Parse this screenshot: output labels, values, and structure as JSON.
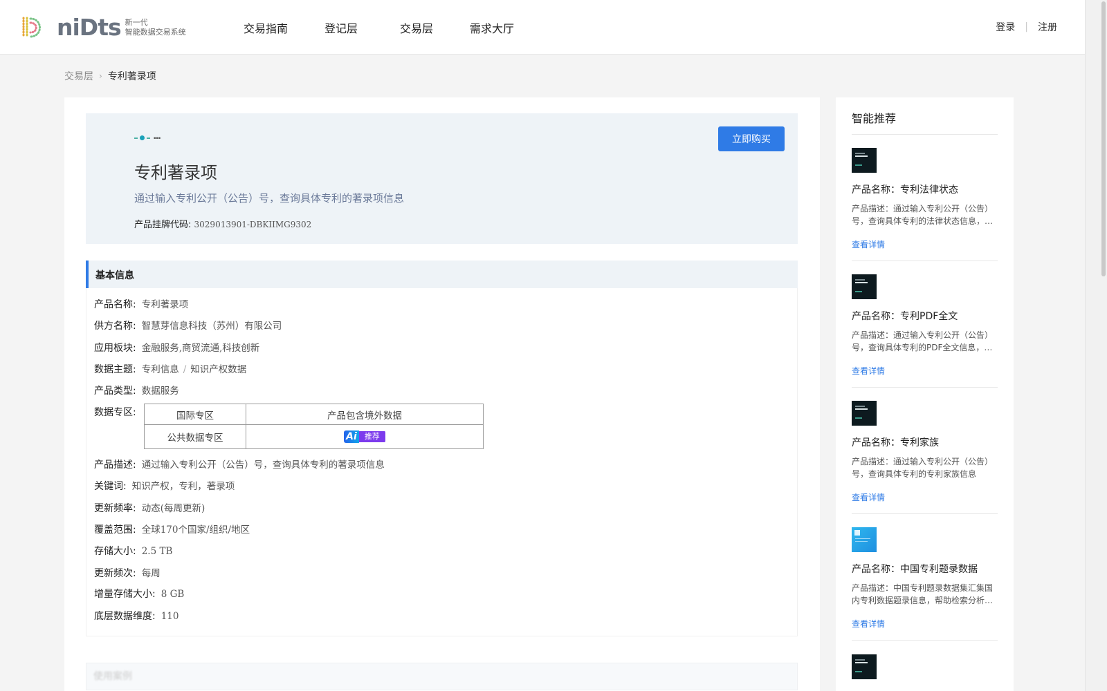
{
  "header": {
    "logo_word": "niDts",
    "logo_sub_line1": "新一代",
    "logo_sub_line2": "智能数据交易系统",
    "nav": [
      {
        "label": "交易指南"
      },
      {
        "label": "登记层"
      },
      {
        "label": "交易层"
      },
      {
        "label": "需求大厅"
      }
    ],
    "login": "登录",
    "register": "注册"
  },
  "breadcrumb": {
    "parent": "交易层",
    "current": "专利著录项"
  },
  "hero": {
    "title": "专利著录项",
    "description": "通过输入专利公开（公告）号，查询具体专利的著录项信息",
    "code_label": "产品挂牌代码:",
    "code_value": "3029013901-DBKIIMG9302",
    "buy_button": "立即购买"
  },
  "basic_info": {
    "section_title": "基本信息",
    "fields": {
      "name": {
        "label": "产品名称:",
        "value": "专利著录项"
      },
      "supplier": {
        "label": "供方名称:",
        "value": "智慧芽信息科技（苏州）有限公司"
      },
      "sector": {
        "label": "应用板块:",
        "value": "金融服务,商贸流通,科技创新"
      },
      "topic": {
        "label": "数据主题:",
        "value_a": "专利信息",
        "value_sep": "/",
        "value_b": "知识产权数据"
      },
      "type": {
        "label": "产品类型:",
        "value": "数据服务"
      },
      "zone": {
        "label": "数据专区:"
      },
      "desc": {
        "label": "产品描述:",
        "value": "通过输入专利公开（公告）号，查询具体专利的著录项信息"
      },
      "keywords": {
        "label": "关键词:",
        "value": "知识产权，专利，著录项"
      },
      "freq": {
        "label": "更新频率:",
        "value": "动态(每周更新)"
      },
      "coverage": {
        "label": "覆盖范围:",
        "value": "全球170个国家/组织/地区"
      },
      "storage": {
        "label": "存储大小:",
        "value": "2.5 TB"
      },
      "update_times": {
        "label": "更新频次:",
        "value": "每周"
      },
      "incr_storage": {
        "label": "增量存储大小:",
        "value": "8 GB"
      },
      "dimensions": {
        "label": "底层数据维度:",
        "value": "110"
      }
    },
    "zone_table": {
      "row1": {
        "c1": "国际专区",
        "c2": "产品包含境外数据"
      },
      "row2": {
        "c1": "公共数据专区",
        "badge_ai": "Ai",
        "badge_text": "推荐"
      }
    }
  },
  "bottom_section": {
    "title": "使用案例"
  },
  "sidebar": {
    "title": "智能推荐",
    "items": [
      {
        "name": "产品名称：专利法律状态",
        "desc": "产品描述：通过输入专利公开（公告）号，查询具体专利的法律状态信息，…",
        "link": "查看详情"
      },
      {
        "name": "产品名称：专利PDF全文",
        "desc": "产品描述：通过输入专利公开（公告）号，查询具体专利的PDF全文信息，PD…",
        "link": "查看详情"
      },
      {
        "name": "产品名称：专利家族",
        "desc": "产品描述：通过输入专利公开（公告）号，查询具体专利的专利家族信息",
        "link": "查看详情"
      },
      {
        "name": "产品名称：中国专利题录数据",
        "desc": "产品描述：中国专利题录数据集汇集国内专利数据题录信息，帮助检索分析…",
        "link": "查看详情"
      }
    ]
  },
  "colors": {
    "accent": "#2f7be6",
    "hero_bg": "#eef3f7",
    "page_bg": "#f4f4f4"
  }
}
